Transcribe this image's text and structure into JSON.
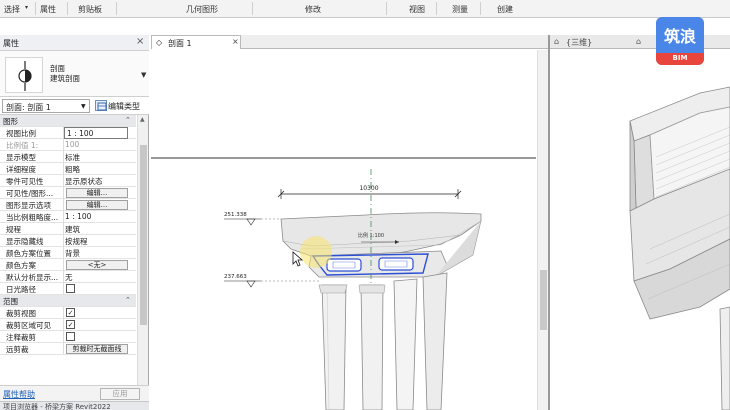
{
  "ribbon": {
    "select": "选择",
    "select_arrow": "▾",
    "properties": "属性",
    "clipboard": "剪贴板",
    "geometry": "几何图形",
    "modify": "修改",
    "view": "视图",
    "measure": "测量",
    "create": "创建"
  },
  "properties_panel": {
    "title": "属性",
    "close": "×",
    "type_family": "剖面",
    "type_name": "建筑剖面",
    "instance_selector": "剖面: 剖面 1",
    "edit_type": "编辑类型",
    "groups": [
      {
        "name": "图形",
        "rows": [
          {
            "label": "视图比例",
            "value": "1 : 100",
            "kind": "input"
          },
          {
            "label": "比例值 1:",
            "value": "100",
            "kind": "grey"
          },
          {
            "label": "显示模型",
            "value": "标准",
            "kind": "text"
          },
          {
            "label": "详细程度",
            "value": "粗略",
            "kind": "text"
          },
          {
            "label": "零件可见性",
            "value": "显示原状态",
            "kind": "text"
          },
          {
            "label": "可见性/图形...",
            "value": "编辑...",
            "kind": "button"
          },
          {
            "label": "图形显示选项",
            "value": "编辑...",
            "kind": "button"
          },
          {
            "label": "当比例粗略度...",
            "value": "1 : 100",
            "kind": "text"
          },
          {
            "label": "规程",
            "value": "建筑",
            "kind": "text"
          },
          {
            "label": "显示隐藏线",
            "value": "按规程",
            "kind": "text"
          },
          {
            "label": "颜色方案位置",
            "value": "背景",
            "kind": "text"
          },
          {
            "label": "颜色方案",
            "value": "<无>",
            "kind": "button"
          },
          {
            "label": "默认分析显示...",
            "value": "无",
            "kind": "text"
          },
          {
            "label": "日光路径",
            "value": "",
            "kind": "checkbox_off"
          }
        ]
      },
      {
        "name": "范围",
        "rows": [
          {
            "label": "裁剪视图",
            "value": "✓",
            "kind": "checkbox_on"
          },
          {
            "label": "裁剪区域可见",
            "value": "✓",
            "kind": "checkbox_on"
          },
          {
            "label": "注释裁剪",
            "value": "",
            "kind": "checkbox_off"
          },
          {
            "label": "远剪裁",
            "value": "剪裁时无截面线",
            "kind": "button"
          }
        ]
      }
    ],
    "help_link": "属性帮助",
    "apply": "应用",
    "browser_caption": "项目浏览器 - 桥梁方案 Revit2022"
  },
  "section_view": {
    "tab_icon": "◇",
    "tab_label": "剖面 1",
    "tab_close": "×",
    "dimension": "10300",
    "level_top": "251.338",
    "level_bottom": "237.663",
    "scale_label": "比例 1:100"
  },
  "view3d": {
    "tab_icon": "⌂",
    "tab_label": "{三维}",
    "tab_icon2": "⌂"
  },
  "watermark": {
    "title": "筑浪",
    "band": "BIM"
  },
  "colors": {
    "accent": "#4a86e8",
    "selection": "#2c4fd6",
    "cursor_highlight": "#f7e36a",
    "watermark_band": "#e8453c"
  }
}
